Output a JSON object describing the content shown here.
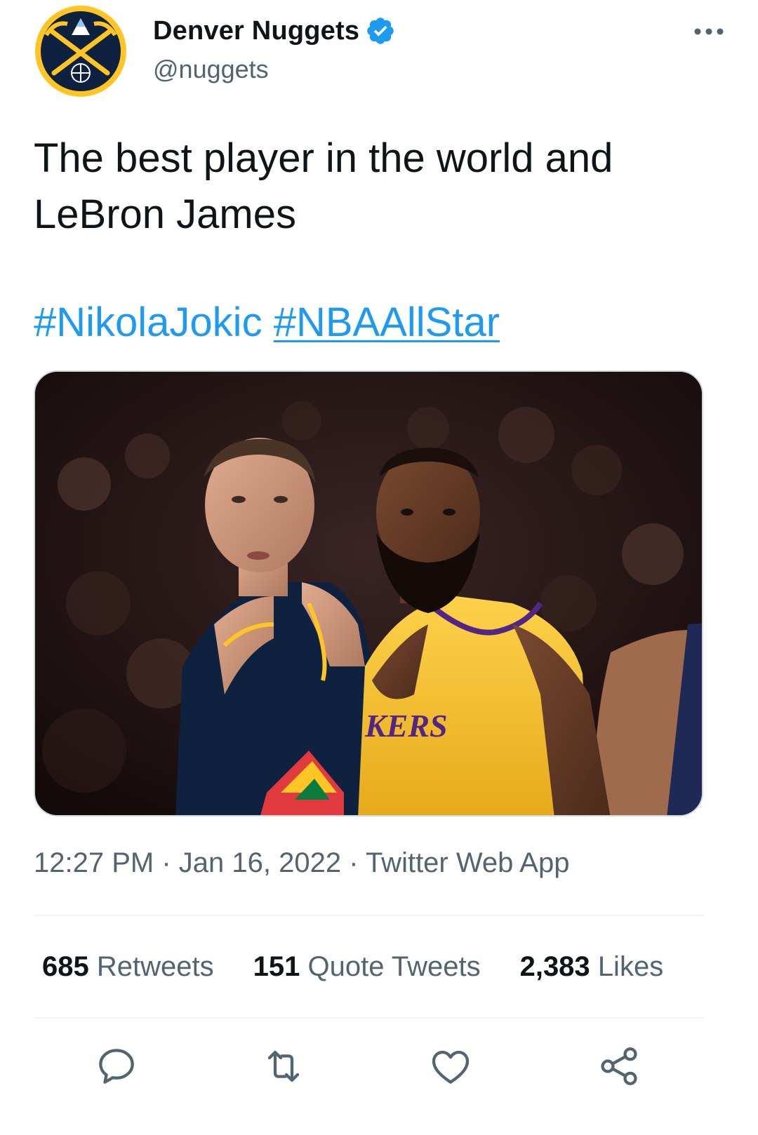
{
  "author": {
    "name": "Denver Nuggets",
    "handle": "@nuggets",
    "verified": true,
    "avatar_icon": "nuggets-logo"
  },
  "tweet": {
    "text": "The best player in the world and LeBron James",
    "hashtags": [
      "#NikolaJokic",
      "#NBAAllStar"
    ]
  },
  "meta": {
    "time": "12:27 PM",
    "date": "Jan 16, 2022",
    "source": "Twitter Web App",
    "separator": "·"
  },
  "stats": [
    {
      "count": "685",
      "label": "Retweets"
    },
    {
      "count": "151",
      "label": "Quote Tweets"
    },
    {
      "count": "2,383",
      "label": "Likes"
    }
  ],
  "actions": [
    "reply-icon",
    "retweet-icon",
    "like-icon",
    "share-icon"
  ],
  "colors": {
    "accent": "#1d9bf0",
    "text": "#0f1419",
    "secondary": "#536471",
    "nuggets_navy": "#0e2240",
    "nuggets_gold": "#fec524",
    "lakers_gold": "#fdb927",
    "lakers_purple": "#552583"
  }
}
